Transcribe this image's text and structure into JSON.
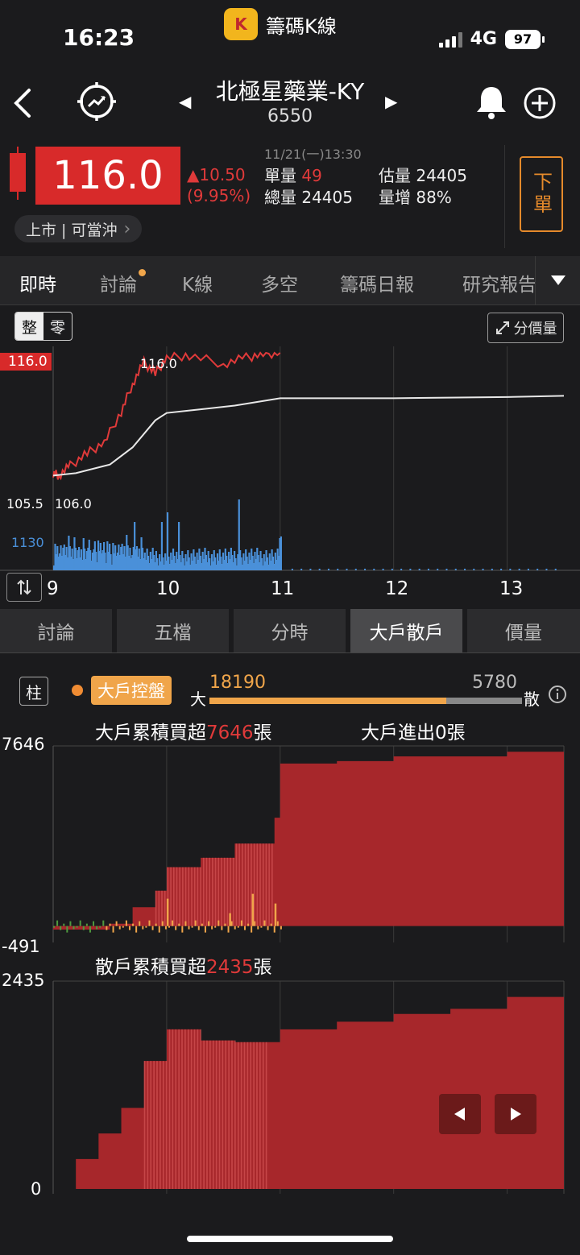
{
  "status_bar": {
    "time": "16:23",
    "app_logo": "K",
    "app_name": "籌碼K線",
    "network": "4G",
    "battery": "97"
  },
  "header": {
    "back_icon": "chevron-left-icon",
    "stock_name": "北極星藥業-KY",
    "stock_code": "6550",
    "prev_arrow": "◀",
    "next_arrow": "▶"
  },
  "quote": {
    "price": "116.0",
    "change": "▲10.50",
    "change_pct": "(9.95%)",
    "datetime": "11/21(一)13:30",
    "single_vol_label": "單量",
    "single_vol": "49",
    "est_vol_label": "估量",
    "est_vol": "24405",
    "total_vol_label": "總量",
    "total_vol": "24405",
    "vol_inc_label": "量增",
    "vol_inc": "88%",
    "order_label": "下單",
    "market_tag": "上市 | 可當沖",
    "chevron": "›"
  },
  "tabs": [
    "即時",
    "討論",
    "K線",
    "多空",
    "籌碼日報",
    "研究報告"
  ],
  "intraday": {
    "toggle_on": "整",
    "toggle_off": "零",
    "price_volume_btn": "分價量",
    "price_high_label": "116.0",
    "peak_label": "116.0",
    "low_label": "106.0",
    "axis_low": "105.5",
    "vol_axis": "1130",
    "x_labels": [
      "9",
      "10",
      "11",
      "12",
      "13"
    ]
  },
  "sub_tabs": [
    "討論",
    "五檔",
    "分時",
    "大戶散戶",
    "價量"
  ],
  "major": {
    "chart_type_btn": "柱",
    "tag": "大戶控盤",
    "big_label": "大",
    "big_value": "18190",
    "small_value": "5780",
    "small_label": "散",
    "big_ratio": 0.759,
    "cum_title_prefix": "大戶累積買超",
    "cum_value": "7646",
    "unit": "張",
    "inout_label": "大戶進出",
    "inout_value": "0",
    "inout_unit": "張",
    "axis_top": "7646",
    "axis_bottom": "-491"
  },
  "retail": {
    "cum_title_prefix": "散戶累積買超",
    "cum_value": "2435",
    "unit": "張",
    "axis_top": "2435",
    "axis_bottom": "0"
  },
  "colors": {
    "up": "#e03a3a",
    "major_fill": "#a7272b",
    "orange": "#f0a54a",
    "volume": "#4a90d9"
  },
  "chart_data": [
    {
      "type": "line",
      "series": [
        {
          "values_x": [
            9.0,
            9.05,
            9.15,
            9.3,
            9.45,
            9.6,
            9.7,
            9.8,
            9.9,
            10.0,
            10.2,
            10.5,
            10.7,
            10.85,
            11.0
          ],
          "values_y": [
            106.2,
            106.0,
            106.8,
            107.8,
            108.7,
            111.2,
            113.5,
            115.2,
            114.3,
            115.6,
            115.8,
            115.1,
            115.6,
            115.9,
            116.0
          ]
        },
        {
          "values_x": [
            9.0,
            9.2,
            9.5,
            9.7,
            9.9,
            10.0,
            10.3,
            10.6,
            11.0,
            12.0,
            13.0,
            13.5
          ],
          "values_y": [
            106.0,
            106.2,
            106.9,
            108.3,
            110.5,
            111.1,
            111.4,
            111.7,
            112.3,
            112.3,
            112.4,
            112.5
          ]
        }
      ],
      "xlim": [
        9,
        13.5
      ],
      "ylim": [
        105.5,
        116.0
      ]
    },
    {
      "type": "area",
      "x": [
        9.0,
        9.5,
        9.7,
        9.9,
        10.0,
        10.3,
        10.6,
        10.95,
        11.0,
        11.5,
        12.0,
        13.0,
        13.5
      ],
      "values": [
        -150,
        100,
        800,
        1500,
        2500,
        2900,
        3500,
        4600,
        6900,
        7000,
        7200,
        7400,
        7646
      ],
      "ylim": [
        -491,
        7646
      ]
    },
    {
      "type": "area",
      "x": [
        9.0,
        9.2,
        9.4,
        9.6,
        9.8,
        10.0,
        10.3,
        10.6,
        11.0,
        11.5,
        12.0,
        12.5,
        13.0,
        13.5
      ],
      "values": [
        0,
        350,
        650,
        950,
        1500,
        1870,
        1740,
        1720,
        1870,
        1960,
        2050,
        2110,
        2250,
        2435
      ],
      "ylim": [
        0,
        2435
      ]
    }
  ]
}
